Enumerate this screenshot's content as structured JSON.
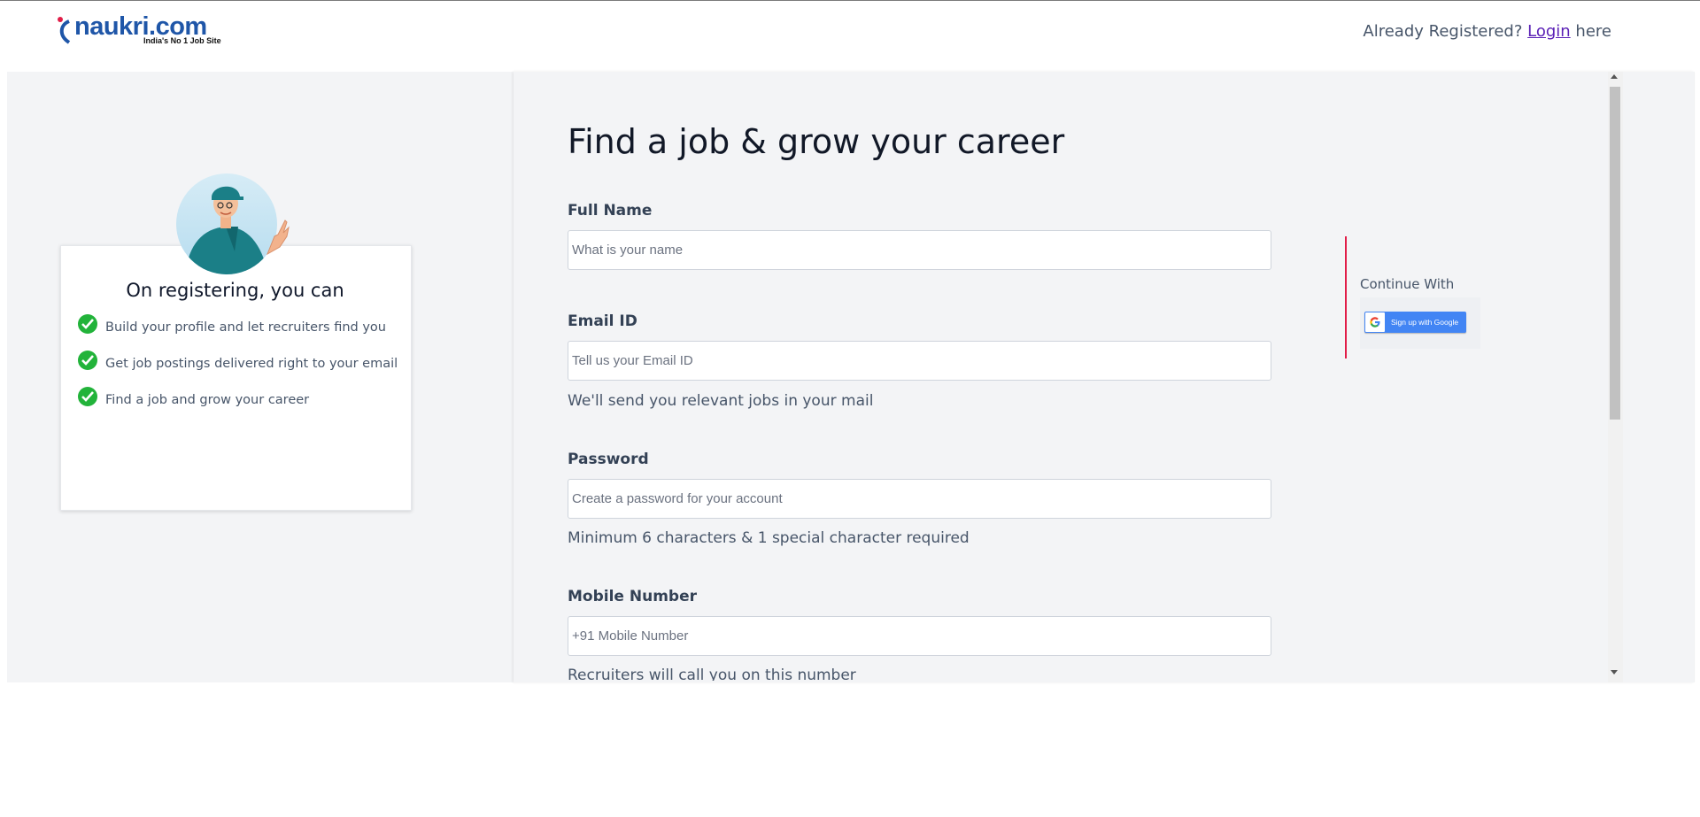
{
  "brand": {
    "name": "naukri.com",
    "tagline": "India's No 1 Job Site"
  },
  "header": {
    "already_text": "Already Registered?",
    "login_link": "Login",
    "here_text": " here"
  },
  "sidebar": {
    "title": "On registering, you can",
    "benefits": [
      "Build your profile and let recruiters find you",
      "Get job postings delivered right to your email",
      "Find a job and grow your career"
    ]
  },
  "form": {
    "title": "Find a job & grow your career",
    "full_name": {
      "label": "Full Name",
      "placeholder": "What is your name"
    },
    "email": {
      "label": "Email ID",
      "placeholder": "Tell us your Email ID",
      "hint": "We'll send you relevant jobs in your mail"
    },
    "password": {
      "label": "Password",
      "placeholder": "Create a password for your account",
      "hint": "Minimum 6 characters & 1 special character required"
    },
    "mobile": {
      "label": "Mobile Number",
      "placeholder": "+91 Mobile Number",
      "hint": "Recruiters will call you on this number"
    }
  },
  "social": {
    "continue_label": "Continue With",
    "google_button": "Sign up with Google"
  },
  "colors": {
    "brand_blue": "#1f56a8",
    "check_green": "#22b33a",
    "google_blue": "#4285f4",
    "divider_red": "#e11d48",
    "panel_bg": "#f3f4f6"
  },
  "icons": [
    "naukri-logo",
    "check-icon",
    "google-icon",
    "scroll-up-arrow",
    "scroll-down-arrow"
  ]
}
